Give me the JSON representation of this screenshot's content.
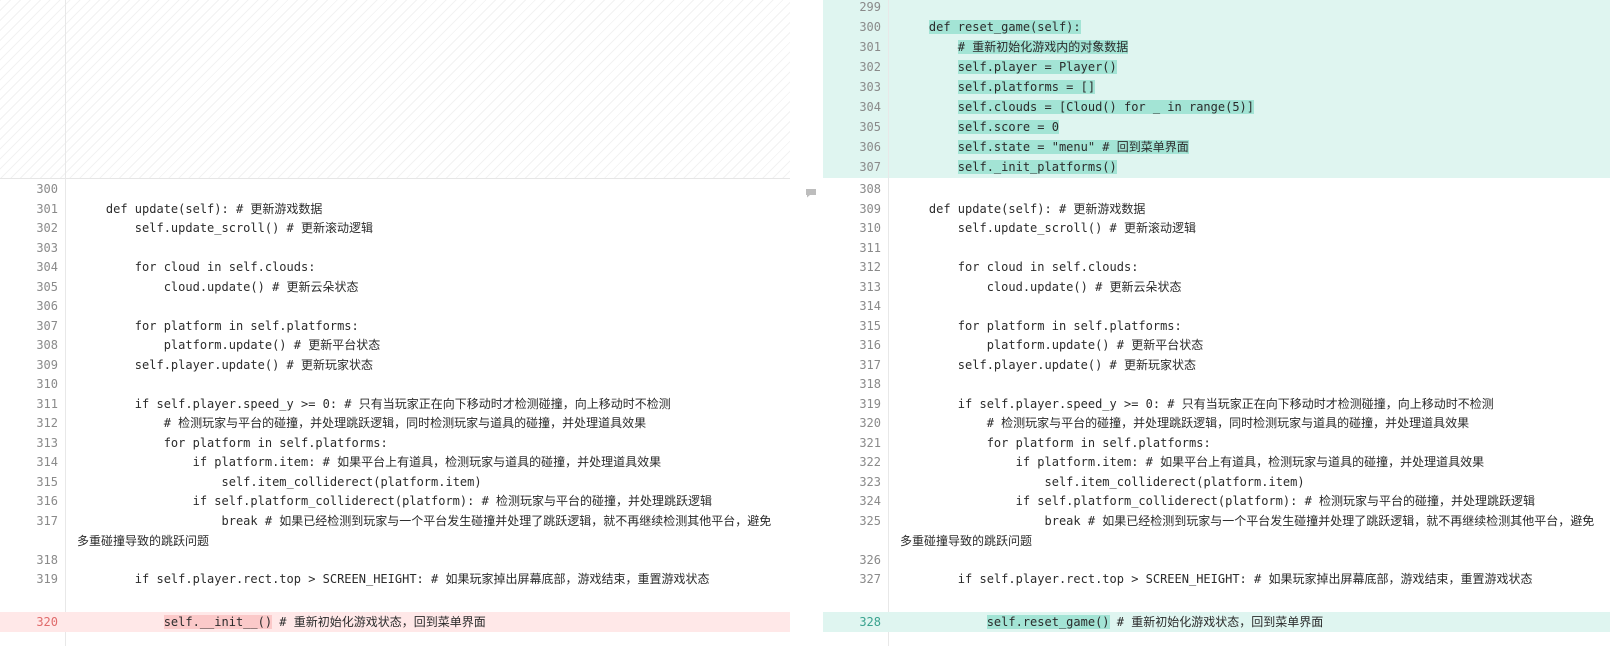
{
  "colors": {
    "added_bg": "#dff5f0",
    "added_highlight": "#a3e4d5",
    "removed_bg": "#ffe8e8",
    "removed_highlight": "#fbc9c9",
    "line_number": "#8a8a8a"
  },
  "left": {
    "lines": [
      {
        "n": "300",
        "text": ""
      },
      {
        "n": "301",
        "text": "    def update(self): # 更新游戏数据"
      },
      {
        "n": "302",
        "text": "        self.update_scroll() # 更新滚动逻辑"
      },
      {
        "n": "303",
        "text": ""
      },
      {
        "n": "304",
        "text": "        for cloud in self.clouds:"
      },
      {
        "n": "305",
        "text": "            cloud.update() # 更新云朵状态"
      },
      {
        "n": "306",
        "text": ""
      },
      {
        "n": "307",
        "text": "        for platform in self.platforms:"
      },
      {
        "n": "308",
        "text": "            platform.update() # 更新平台状态"
      },
      {
        "n": "309",
        "text": "        self.player.update() # 更新玩家状态"
      },
      {
        "n": "310",
        "text": ""
      },
      {
        "n": "311",
        "text": "        if self.player.speed_y >= 0: # 只有当玩家正在向下移动时才检测碰撞，向上移动时不检测"
      },
      {
        "n": "312",
        "text": "            # 检测玩家与平台的碰撞，并处理跳跃逻辑，同时检测玩家与道具的碰撞，并处理道具效果"
      },
      {
        "n": "313",
        "text": "            for platform in self.platforms:"
      },
      {
        "n": "314",
        "text": "                if platform.item: # 如果平台上有道具，检测玩家与道具的碰撞，并处理道具效果"
      },
      {
        "n": "315",
        "text": "                    self.item_colliderect(platform.item)"
      },
      {
        "n": "316",
        "text": "                if self.platform_colliderect(platform): # 检测玩家与平台的碰撞，并处理跳跃逻辑"
      },
      {
        "n": "317",
        "text": "                    break # 如果已经检测到玩家与一个平台发生碰撞并处理了跳跃逻辑，就不再继续检测其他平台，避免多重碰撞导致的跳跃问题"
      },
      {
        "n": "318",
        "text": ""
      },
      {
        "n": "319",
        "text": "        if self.player.rect.top > SCREEN_HEIGHT: # 如果玩家掉出屏幕底部，游戏结束，重置游戏状态"
      }
    ],
    "removed_line": {
      "n": "320",
      "indent": "            ",
      "hl": "self.__init__()",
      "rest": " # 重新初始化游戏状态，回到菜单界面"
    }
  },
  "right": {
    "added_lines": [
      {
        "n": "299",
        "indent": "",
        "hl": ""
      },
      {
        "n": "300",
        "indent": "    ",
        "hl": "def reset_game(self):"
      },
      {
        "n": "301",
        "indent": "        ",
        "hl": "# 重新初始化游戏内的对象数据"
      },
      {
        "n": "302",
        "indent": "        ",
        "hl": "self.player = Player()"
      },
      {
        "n": "303",
        "indent": "        ",
        "hl": "self.platforms = []"
      },
      {
        "n": "304",
        "indent": "        ",
        "hl": "self.clouds = [Cloud() for _ in range(5)]"
      },
      {
        "n": "305",
        "indent": "        ",
        "hl": "self.score = 0"
      },
      {
        "n": "306",
        "indent": "        ",
        "hl": "self.state = \"menu\" # 回到菜单界面"
      },
      {
        "n": "307",
        "indent": "        ",
        "hl": "self._init_platforms()"
      }
    ],
    "lines": [
      {
        "n": "308",
        "text": ""
      },
      {
        "n": "309",
        "text": "    def update(self): # 更新游戏数据"
      },
      {
        "n": "310",
        "text": "        self.update_scroll() # 更新滚动逻辑"
      },
      {
        "n": "311",
        "text": ""
      },
      {
        "n": "312",
        "text": "        for cloud in self.clouds:"
      },
      {
        "n": "313",
        "text": "            cloud.update() # 更新云朵状态"
      },
      {
        "n": "314",
        "text": ""
      },
      {
        "n": "315",
        "text": "        for platform in self.platforms:"
      },
      {
        "n": "316",
        "text": "            platform.update() # 更新平台状态"
      },
      {
        "n": "317",
        "text": "        self.player.update() # 更新玩家状态"
      },
      {
        "n": "318",
        "text": ""
      },
      {
        "n": "319",
        "text": "        if self.player.speed_y >= 0: # 只有当玩家正在向下移动时才检测碰撞，向上移动时不检测"
      },
      {
        "n": "320",
        "text": "            # 检测玩家与平台的碰撞，并处理跳跃逻辑，同时检测玩家与道具的碰撞，并处理道具效果"
      },
      {
        "n": "321",
        "text": "            for platform in self.platforms:"
      },
      {
        "n": "322",
        "text": "                if platform.item: # 如果平台上有道具，检测玩家与道具的碰撞，并处理道具效果"
      },
      {
        "n": "323",
        "text": "                    self.item_colliderect(platform.item)"
      },
      {
        "n": "324",
        "text": "                if self.platform_colliderect(platform): # 检测玩家与平台的碰撞，并处理跳跃逻辑"
      },
      {
        "n": "325",
        "text": "                    break # 如果已经检测到玩家与一个平台发生碰撞并处理了跳跃逻辑，就不再继续检测其他平台，避免多重碰撞导致的跳跃问题"
      },
      {
        "n": "326",
        "text": ""
      },
      {
        "n": "327",
        "text": "        if self.player.rect.top > SCREEN_HEIGHT: # 如果玩家掉出屏幕底部，游戏结束，重置游戏状态"
      }
    ],
    "added_line": {
      "n": "328",
      "indent": "            ",
      "hl": "self.reset_game()",
      "rest": " # 重新初始化游戏状态，回到菜单界面"
    }
  }
}
